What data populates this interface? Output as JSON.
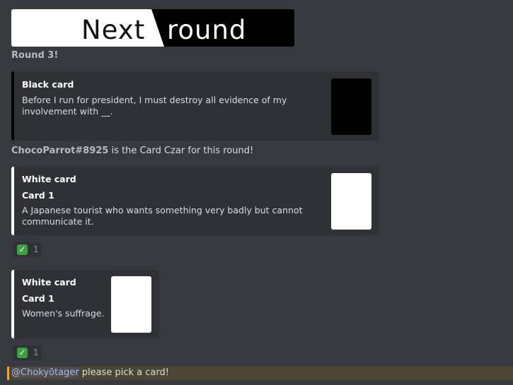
{
  "banner": {
    "word1": "Next",
    "word2": "round"
  },
  "round_label": "Round 3!",
  "black_card": {
    "title": "Black card",
    "text": "Before I run for president, I must destroy all evidence of my involvement with __.",
    "color": "#000000"
  },
  "czar": {
    "user": "ChocoParrot#8925",
    "text": " is the Card Czar for this round!"
  },
  "white_cards": [
    {
      "title": "White card",
      "field": "Card 1",
      "text": "A Japanese tourist who wants something very badly but cannot communicate it.",
      "reaction_count": "1"
    },
    {
      "title": "White card",
      "field": "Card 1",
      "text": "Women's suffrage.",
      "reaction_count": "1"
    }
  ],
  "reaction_icon": "check-mark-icon",
  "mention": {
    "user": "@Chokyōtager",
    "text": " please pick a card!"
  },
  "colors": {
    "background": "#36393f",
    "embed": "#2f3136",
    "white_bar": "#ffffff",
    "black_bar": "#000000",
    "mention_highlight": "#faa61a"
  }
}
